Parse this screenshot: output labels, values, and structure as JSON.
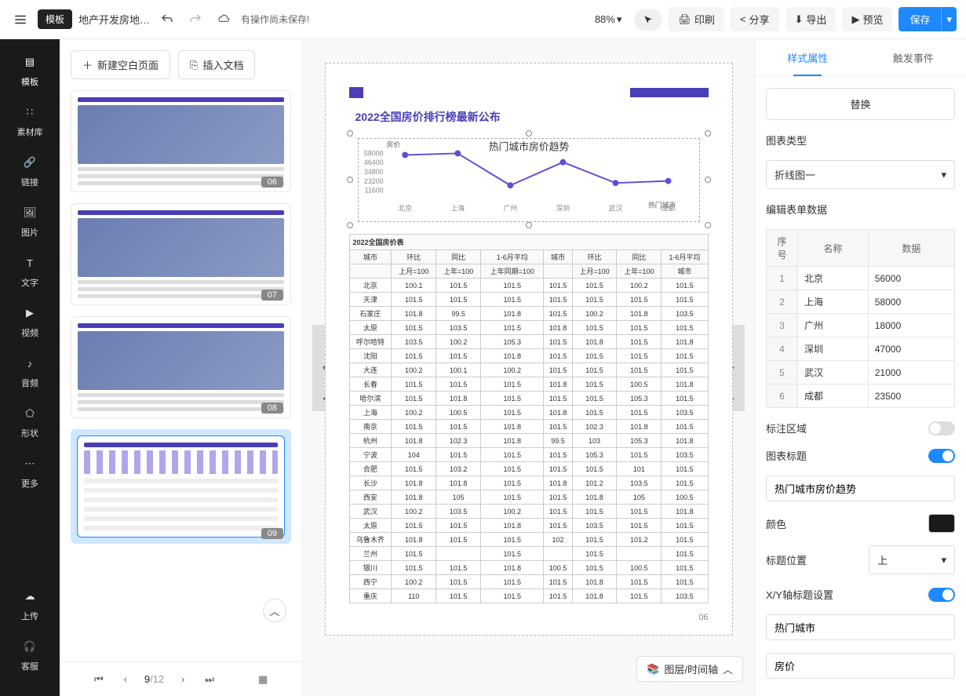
{
  "topbar": {
    "template_badge": "模板",
    "doc_title": "地产开发房地…",
    "unsaved": "有操作尚未保存!",
    "zoom": "88%",
    "print": "印刷",
    "share": "分享",
    "export": "导出",
    "preview": "预览",
    "save": "保存"
  },
  "sidebar_left": {
    "items": [
      {
        "icon": "template",
        "label": "模板"
      },
      {
        "icon": "assets",
        "label": "素材库"
      },
      {
        "icon": "link",
        "label": "链接"
      },
      {
        "icon": "image",
        "label": "图片"
      },
      {
        "icon": "text",
        "label": "文字"
      },
      {
        "icon": "video",
        "label": "视频"
      },
      {
        "icon": "audio",
        "label": "音频"
      },
      {
        "icon": "shape",
        "label": "形状"
      },
      {
        "icon": "more",
        "label": "更多"
      }
    ],
    "bottom": [
      {
        "icon": "upload",
        "label": "上传"
      },
      {
        "icon": "support",
        "label": "客服"
      }
    ]
  },
  "thumbs": {
    "new_page": "新建空白页面",
    "insert_doc": "插入文档",
    "pages": [
      "06",
      "07",
      "08",
      "09"
    ],
    "pager_current": "9",
    "pager_total": "/12"
  },
  "canvas": {
    "title": "2022全国房价排行榜最新公布",
    "table_title": "2022全国房价表",
    "page_num": "06",
    "headers_group1": [
      "城市",
      "环比",
      "同比",
      "1-6月平均"
    ],
    "sub_headers1": [
      "",
      "上月=100",
      "上年=100",
      "上年同期=100"
    ],
    "headers_group2": [
      "城市",
      "环比",
      "同比",
      "1-6月平均"
    ],
    "sub_headers2": [
      "",
      "上月=100",
      "上年=100",
      "城市"
    ],
    "rows": [
      [
        "北京",
        "100.1",
        "101.5",
        "101.5",
        "101.5",
        "101.5",
        "100.2",
        "101.5"
      ],
      [
        "天津",
        "101.5",
        "101.5",
        "101.5",
        "101.5",
        "101.5",
        "101.5",
        "101.5"
      ],
      [
        "石家庄",
        "101.8",
        "99.5",
        "101.8",
        "101.5",
        "100.2",
        "101.8",
        "103.5"
      ],
      [
        "太原",
        "101.5",
        "103.5",
        "101.5",
        "101.8",
        "101.5",
        "101.5",
        "101.5"
      ],
      [
        "呼尔哈特",
        "103.5",
        "100.2",
        "105.3",
        "101.5",
        "101.8",
        "101.5",
        "101.8"
      ],
      [
        "沈阳",
        "101.5",
        "101.5",
        "101.8",
        "101.5",
        "101.5",
        "101.5",
        "101.5"
      ],
      [
        "大连",
        "100.2",
        "100.1",
        "100.2",
        "101.5",
        "101.5",
        "101.5",
        "101.5"
      ],
      [
        "长春",
        "101.5",
        "101.5",
        "101.5",
        "101.8",
        "101.5",
        "100.5",
        "101.8"
      ],
      [
        "哈尔滨",
        "101.5",
        "101.8",
        "101.5",
        "101.5",
        "101.5",
        "105.3",
        "101.5"
      ],
      [
        "上海",
        "100.2",
        "100.5",
        "101.5",
        "101.8",
        "101.5",
        "101.5",
        "103.5"
      ],
      [
        "南京",
        "101.5",
        "101.5",
        "101.8",
        "101.5",
        "102.3",
        "101.8",
        "101.5"
      ],
      [
        "杭州",
        "101.8",
        "102.3",
        "101.8",
        "99.5",
        "103",
        "105.3",
        "101.8"
      ],
      [
        "宁波",
        "104",
        "101.5",
        "101.5",
        "101.5",
        "105.3",
        "101.5",
        "103.5"
      ],
      [
        "合肥",
        "101.5",
        "103.2",
        "101.5",
        "101.5",
        "101.5",
        "101",
        "101.5"
      ],
      [
        "长沙",
        "101.8",
        "101.8",
        "101.5",
        "101.8",
        "101.2",
        "103.5",
        "101.5"
      ],
      [
        "西安",
        "101.8",
        "105",
        "101.5",
        "101.5",
        "101.8",
        "105",
        "100.5"
      ],
      [
        "武汉",
        "100.2",
        "103.5",
        "100.2",
        "101.5",
        "101.5",
        "101.5",
        "101.8"
      ],
      [
        "太原",
        "101.5",
        "101.5",
        "101.8",
        "101.5",
        "103.5",
        "101.5",
        "101.5"
      ],
      [
        "乌鲁木齐",
        "101.8",
        "101.5",
        "101.5",
        "102",
        "101.5",
        "101.2",
        "101.5"
      ],
      [
        "兰州",
        "101.5",
        "",
        "101.5",
        "",
        "101.5",
        "",
        "101.5"
      ],
      [
        "银川",
        "101.5",
        "101.5",
        "101.8",
        "100.5",
        "101.5",
        "100.5",
        "101.5"
      ],
      [
        "西宁",
        "100.2",
        "101.5",
        "101.5",
        "101.5",
        "101.8",
        "101.5",
        "101.5"
      ],
      [
        "重庆",
        "110",
        "101.5",
        "101.5",
        "101.5",
        "101.8",
        "101.5",
        "103.5"
      ]
    ]
  },
  "panel_right": {
    "tab_style": "样式属性",
    "tab_event": "触发事件",
    "replace": "替换",
    "chart_type_label": "图表类型",
    "chart_type_value": "折线图一",
    "edit_data_label": "编辑表单数据",
    "col_index": "序号",
    "col_name": "名称",
    "col_value": "数据",
    "annotation_label": "标注区域",
    "chart_title_label": "图表标题",
    "chart_title_value": "热门城市房价趋势",
    "color_label": "颜色",
    "title_pos_label": "标题位置",
    "title_pos_value": "上",
    "axis_title_label": "X/Y轴标题设置",
    "x_axis_value": "热门城市",
    "y_axis_value": "房价"
  },
  "layer_btn": "图层/时间轴",
  "chart_data": {
    "type": "line",
    "title": "热门城市房价趋势",
    "xlabel": "热门城市",
    "ylabel": "房价",
    "categories": [
      "北京",
      "上海",
      "广州",
      "深圳",
      "武汉",
      "成都"
    ],
    "values": [
      56000,
      58000,
      18000,
      47000,
      21000,
      23500
    ],
    "y_ticks": [
      11600,
      23200,
      34800,
      46400,
      58000
    ],
    "ylim": [
      0,
      58000
    ]
  }
}
